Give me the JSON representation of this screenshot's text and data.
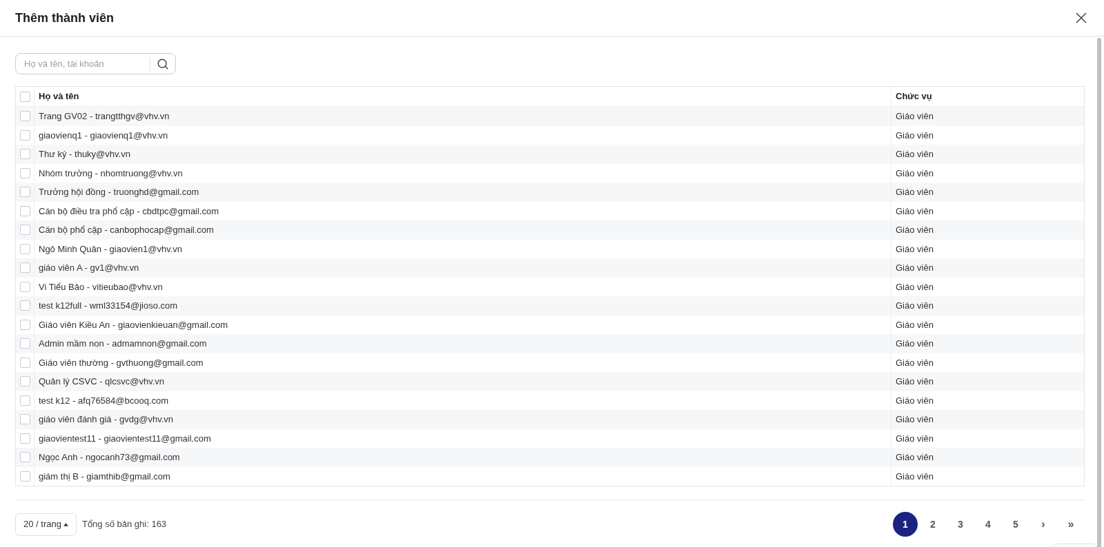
{
  "dialog": {
    "title": "Thêm thành viên"
  },
  "search": {
    "placeholder": "Họ và tên, tài khoản"
  },
  "table": {
    "select_all_checked": false,
    "columns": [
      "Họ và tên",
      "Chức vụ"
    ],
    "rows": [
      {
        "member": "Trang GV02 - trangtthgv@vhv.vn",
        "role": "Giáo viên",
        "checked": false
      },
      {
        "member": "giaovienq1 - giaovienq1@vhv.vn",
        "role": "Giáo viên",
        "checked": false
      },
      {
        "member": "Thư ký - thuky@vhv.vn",
        "role": "Giáo viên",
        "checked": false
      },
      {
        "member": "Nhóm trưởng - nhomtruong@vhv.vn",
        "role": "Giáo viên",
        "checked": false
      },
      {
        "member": "Trưởng hội đồng - truonghd@gmail.com",
        "role": "Giáo viên",
        "checked": false
      },
      {
        "member": "Cán bộ điều tra phổ cập - cbdtpc@gmail.com",
        "role": "Giáo viên",
        "checked": false
      },
      {
        "member": "Cán bộ phổ cập - canbophocap@gmail.com",
        "role": "Giáo viên",
        "checked": false
      },
      {
        "member": "Ngô Minh Quân - giaovien1@vhv.vn",
        "role": "Giáo viên",
        "checked": false
      },
      {
        "member": "giáo viên A - gv1@vhv.vn",
        "role": "Giáo viên",
        "checked": false
      },
      {
        "member": "Vi Tiểu Bảo - vitieubao@vhv.vn",
        "role": "Giáo viên",
        "checked": false
      },
      {
        "member": "test k12full - wml33154@jioso.com",
        "role": "Giáo viên",
        "checked": false
      },
      {
        "member": "Giáo viên Kiều An - giaovienkieuan@gmail.com",
        "role": "Giáo viên",
        "checked": false
      },
      {
        "member": "Admin mầm non - admamnon@gmail.com",
        "role": "Giáo viên",
        "checked": false
      },
      {
        "member": "Giáo viên thường - gvthuong@gmail.com",
        "role": "Giáo viên",
        "checked": false
      },
      {
        "member": "Quản lý CSVC - qlcsvc@vhv.vn",
        "role": "Giáo viên",
        "checked": false
      },
      {
        "member": "test k12 - afq76584@bcooq.com",
        "role": "Giáo viên",
        "checked": false
      },
      {
        "member": "giáo viên đánh giá - gvdg@vhv.vn",
        "role": "Giáo viên",
        "checked": false
      },
      {
        "member": "giaovientest11 - giaovientest11@gmail.com",
        "role": "Giáo viên",
        "checked": false
      },
      {
        "member": "Ngọc Anh - ngocanh73@gmail.com",
        "role": "Giáo viên",
        "checked": false
      },
      {
        "member": "giám thị B - giamthib@gmail.com",
        "role": "Giáo viên",
        "checked": false
      }
    ]
  },
  "pagination": {
    "page_size": "20 / trang",
    "total": "Tổng số bản ghi: 163",
    "pages": [
      {
        "label": "1",
        "selected": true
      },
      {
        "label": "2",
        "selected": false
      },
      {
        "label": "3",
        "selected": false
      },
      {
        "label": "4",
        "selected": false
      },
      {
        "label": "5",
        "selected": false
      }
    ],
    "next": "›",
    "last": "»"
  }
}
